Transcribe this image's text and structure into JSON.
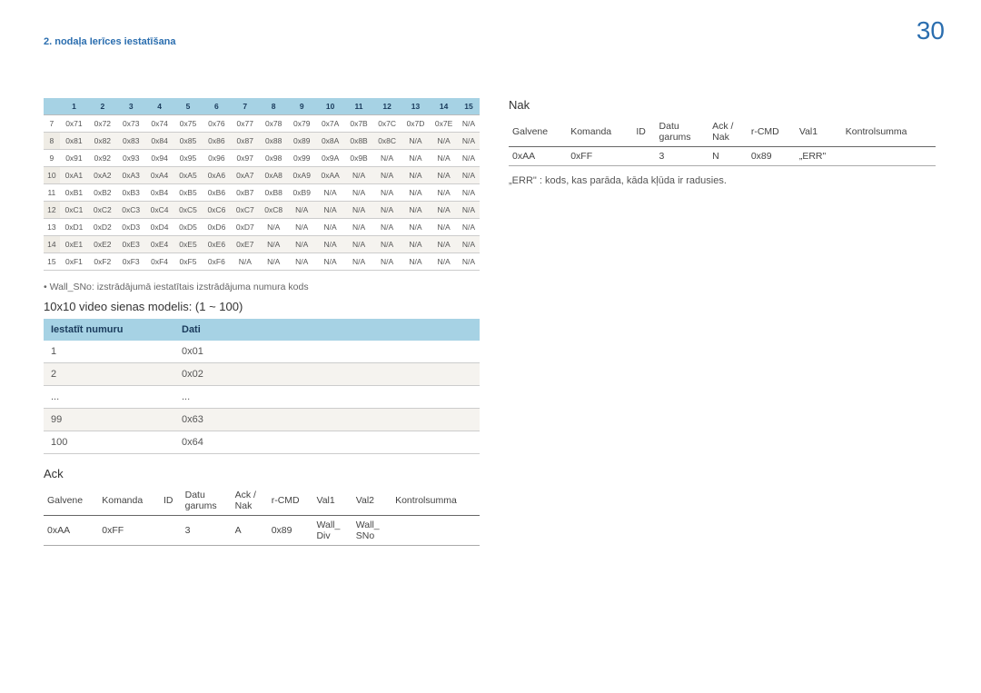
{
  "page_number": "30",
  "chapter": "2. nodaļa Ierīces iestatīšana",
  "hex": {
    "header": [
      "",
      "1",
      "2",
      "3",
      "4",
      "5",
      "6",
      "7",
      "8",
      "9",
      "10",
      "11",
      "12",
      "13",
      "14",
      "15"
    ],
    "rows": [
      [
        "7",
        "0x71",
        "0x72",
        "0x73",
        "0x74",
        "0x75",
        "0x76",
        "0x77",
        "0x78",
        "0x79",
        "0x7A",
        "0x7B",
        "0x7C",
        "0x7D",
        "0x7E",
        "N/A"
      ],
      [
        "8",
        "0x81",
        "0x82",
        "0x83",
        "0x84",
        "0x85",
        "0x86",
        "0x87",
        "0x88",
        "0x89",
        "0x8A",
        "0x8B",
        "0x8C",
        "N/A",
        "N/A",
        "N/A"
      ],
      [
        "9",
        "0x91",
        "0x92",
        "0x93",
        "0x94",
        "0x95",
        "0x96",
        "0x97",
        "0x98",
        "0x99",
        "0x9A",
        "0x9B",
        "N/A",
        "N/A",
        "N/A",
        "N/A"
      ],
      [
        "10",
        "0xA1",
        "0xA2",
        "0xA3",
        "0xA4",
        "0xA5",
        "0xA6",
        "0xA7",
        "0xA8",
        "0xA9",
        "0xAA",
        "N/A",
        "N/A",
        "N/A",
        "N/A",
        "N/A"
      ],
      [
        "11",
        "0xB1",
        "0xB2",
        "0xB3",
        "0xB4",
        "0xB5",
        "0xB6",
        "0xB7",
        "0xB8",
        "0xB9",
        "N/A",
        "N/A",
        "N/A",
        "N/A",
        "N/A",
        "N/A"
      ],
      [
        "12",
        "0xC1",
        "0xC2",
        "0xC3",
        "0xC4",
        "0xC5",
        "0xC6",
        "0xC7",
        "0xC8",
        "N/A",
        "N/A",
        "N/A",
        "N/A",
        "N/A",
        "N/A",
        "N/A"
      ],
      [
        "13",
        "0xD1",
        "0xD2",
        "0xD3",
        "0xD4",
        "0xD5",
        "0xD6",
        "0xD7",
        "N/A",
        "N/A",
        "N/A",
        "N/A",
        "N/A",
        "N/A",
        "N/A",
        "N/A"
      ],
      [
        "14",
        "0xE1",
        "0xE2",
        "0xE3",
        "0xE4",
        "0xE5",
        "0xE6",
        "0xE7",
        "N/A",
        "N/A",
        "N/A",
        "N/A",
        "N/A",
        "N/A",
        "N/A",
        "N/A"
      ],
      [
        "15",
        "0xF1",
        "0xF2",
        "0xF3",
        "0xF4",
        "0xF5",
        "0xF6",
        "N/A",
        "N/A",
        "N/A",
        "N/A",
        "N/A",
        "N/A",
        "N/A",
        "N/A",
        "N/A"
      ]
    ]
  },
  "note_wall_sno": "Wall_SNo: izstrādājumā iestatītais izstrādājuma numura kods",
  "model_title": "10x10 video sienas modelis: (1 ~ 100)",
  "model": {
    "headers": [
      "Iestatīt numuru",
      "Dati"
    ],
    "rows": [
      [
        "1",
        "0x01"
      ],
      [
        "2",
        "0x02"
      ],
      [
        "...",
        "..."
      ],
      [
        "99",
        "0x63"
      ],
      [
        "100",
        "0x64"
      ]
    ]
  },
  "ack": {
    "title": "Ack",
    "headers": [
      "Galvene",
      "Komanda",
      "ID",
      "Datu garums",
      "Ack / Nak",
      "r-CMD",
      "Val1",
      "Val2",
      "Kontrolsumma"
    ],
    "row": [
      "0xAA",
      "0xFF",
      "",
      "3",
      "A",
      "0x89",
      "Wall_Div",
      "Wall_SNo",
      ""
    ]
  },
  "nak": {
    "title": "Nak",
    "headers": [
      "Galvene",
      "Komanda",
      "ID",
      "Datu garums",
      "Ack / Nak",
      "r-CMD",
      "Val1",
      "Kontrolsumma"
    ],
    "row": [
      "0xAA",
      "0xFF",
      "",
      "3",
      "N",
      "0x89",
      "„ERR\"",
      ""
    ]
  },
  "err_note": "„ERR\" : kods, kas parāda, kāda kļūda ir radusies."
}
